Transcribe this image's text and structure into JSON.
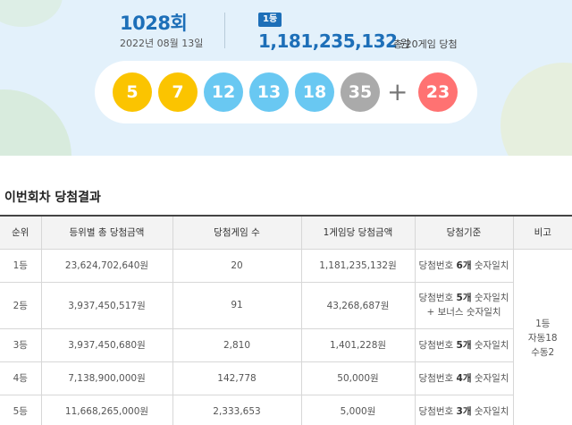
{
  "header": {
    "draw_number": "1028회",
    "draw_date": "2022년 08월 13일",
    "rank_badge": "1등",
    "first_prize_amount": "1,181,235,132",
    "first_prize_unit": "원",
    "first_prize_note": "총 20게임 당첨"
  },
  "winning_numbers": [
    {
      "number": "5",
      "color": "#fbc400"
    },
    {
      "number": "7",
      "color": "#fbc400"
    },
    {
      "number": "12",
      "color": "#69c8f2"
    },
    {
      "number": "13",
      "color": "#69c8f2"
    },
    {
      "number": "18",
      "color": "#69c8f2"
    },
    {
      "number": "35",
      "color": "#aaaaaa"
    }
  ],
  "plus_sign": "+",
  "bonus_number": {
    "number": "23",
    "color": "#ff7272"
  },
  "section_title": "이번회차 당첨결과",
  "table": {
    "headers": [
      "순위",
      "등위별 총 당첨금액",
      "당첨게임 수",
      "1게임당 당첨금액",
      "당첨기준",
      "비고"
    ],
    "rows": [
      {
        "rank": "1등",
        "total": "23,624,702,640원",
        "games": "20",
        "per_game": "1,181,235,132원",
        "criteria_pre": "당첨번호 ",
        "criteria_count": "6개",
        "criteria_post": " 숫자일치",
        "criteria_extra": ""
      },
      {
        "rank": "2등",
        "total": "3,937,450,517원",
        "games": "91",
        "per_game": "43,268,687원",
        "criteria_pre": "당첨번호 ",
        "criteria_count": "5개",
        "criteria_post": " 숫자일치",
        "criteria_extra": "+ 보너스 숫자일치"
      },
      {
        "rank": "3등",
        "total": "3,937,450,680원",
        "games": "2,810",
        "per_game": "1,401,228원",
        "criteria_pre": "당첨번호 ",
        "criteria_count": "5개",
        "criteria_post": " 숫자일치",
        "criteria_extra": ""
      },
      {
        "rank": "4등",
        "total": "7,138,900,000원",
        "games": "142,778",
        "per_game": "50,000원",
        "criteria_pre": "당첨번호 ",
        "criteria_count": "4개",
        "criteria_post": " 숫자일치",
        "criteria_extra": ""
      },
      {
        "rank": "5등",
        "total": "11,668,265,000원",
        "games": "2,333,653",
        "per_game": "5,000원",
        "criteria_pre": "당첨번호 ",
        "criteria_count": "3개",
        "criteria_post": " 숫자일치",
        "criteria_extra": ""
      }
    ],
    "remarks": {
      "line1": "1등",
      "line2": "자동18",
      "line3": "수동2"
    }
  }
}
